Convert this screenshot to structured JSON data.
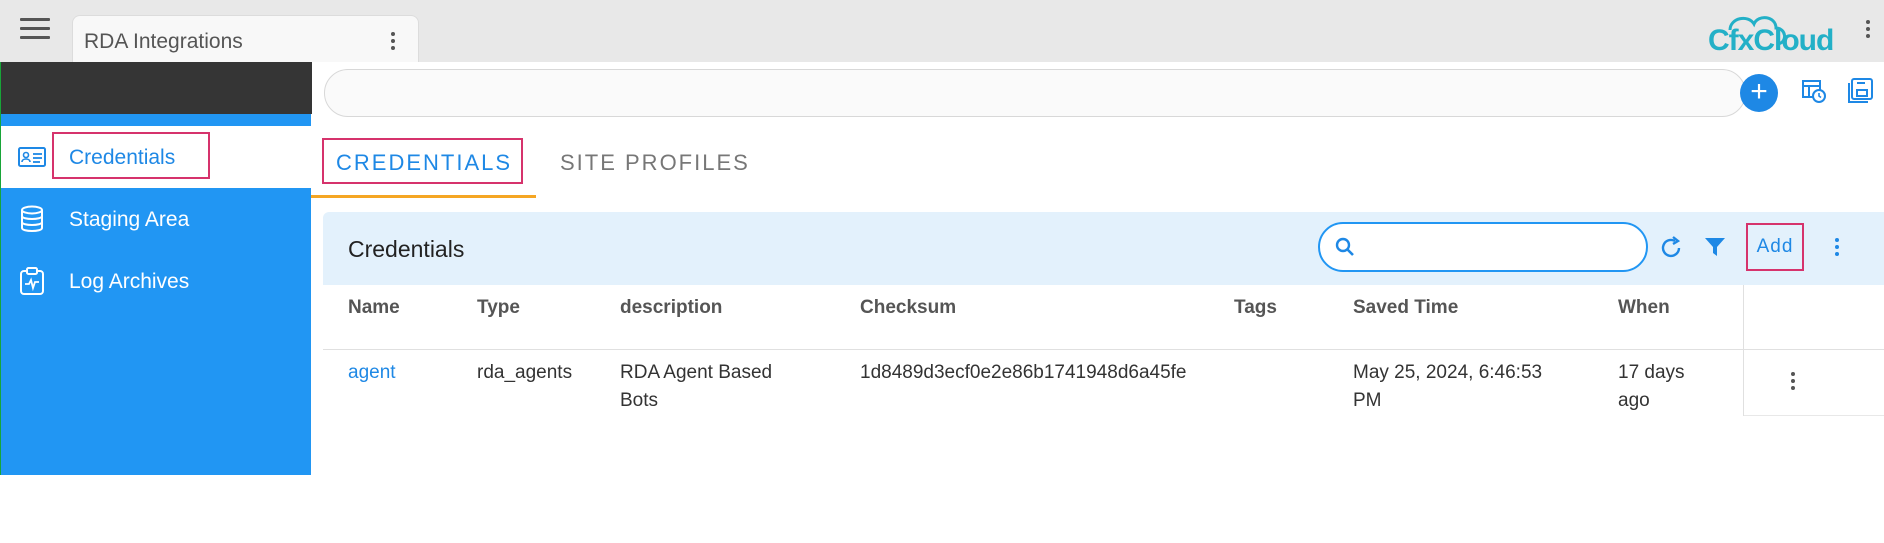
{
  "app": {
    "tab_title": "RDA Integrations",
    "logo_text": "CfxCloud"
  },
  "sidebar": {
    "items": [
      {
        "label": "Credentials",
        "icon": "id-card-icon",
        "active": true
      },
      {
        "label": "Staging Area",
        "icon": "database-icon",
        "active": false
      },
      {
        "label": "Log Archives",
        "icon": "clipboard-icon",
        "active": false
      }
    ]
  },
  "search": {
    "placeholder": ""
  },
  "tabs": [
    {
      "label": "CREDENTIALS",
      "active": true
    },
    {
      "label": "SITE PROFILES",
      "active": false
    }
  ],
  "panel": {
    "title": "Credentials",
    "search_placeholder": "",
    "add_label": "Add"
  },
  "table": {
    "columns": [
      "Name",
      "Type",
      "description",
      "Checksum",
      "Tags",
      "Saved Time",
      "When"
    ],
    "rows": [
      {
        "name": "agent",
        "type": "rda_agents",
        "description_line1": "RDA Agent Based",
        "description_line2": "Bots",
        "checksum": "1d8489d3ecf0e2e86b1741948d6a45fe",
        "tags": "",
        "saved_time_line1": "May 25, 2024, 6:46:53",
        "saved_time_line2": "PM",
        "when_line1": "17 days",
        "when_line2": "ago"
      }
    ]
  },
  "colors": {
    "accent": "#1e88e5",
    "sidebar": "#2196f3",
    "highlight": "#d6336c",
    "tab_underline": "#f5a623"
  }
}
